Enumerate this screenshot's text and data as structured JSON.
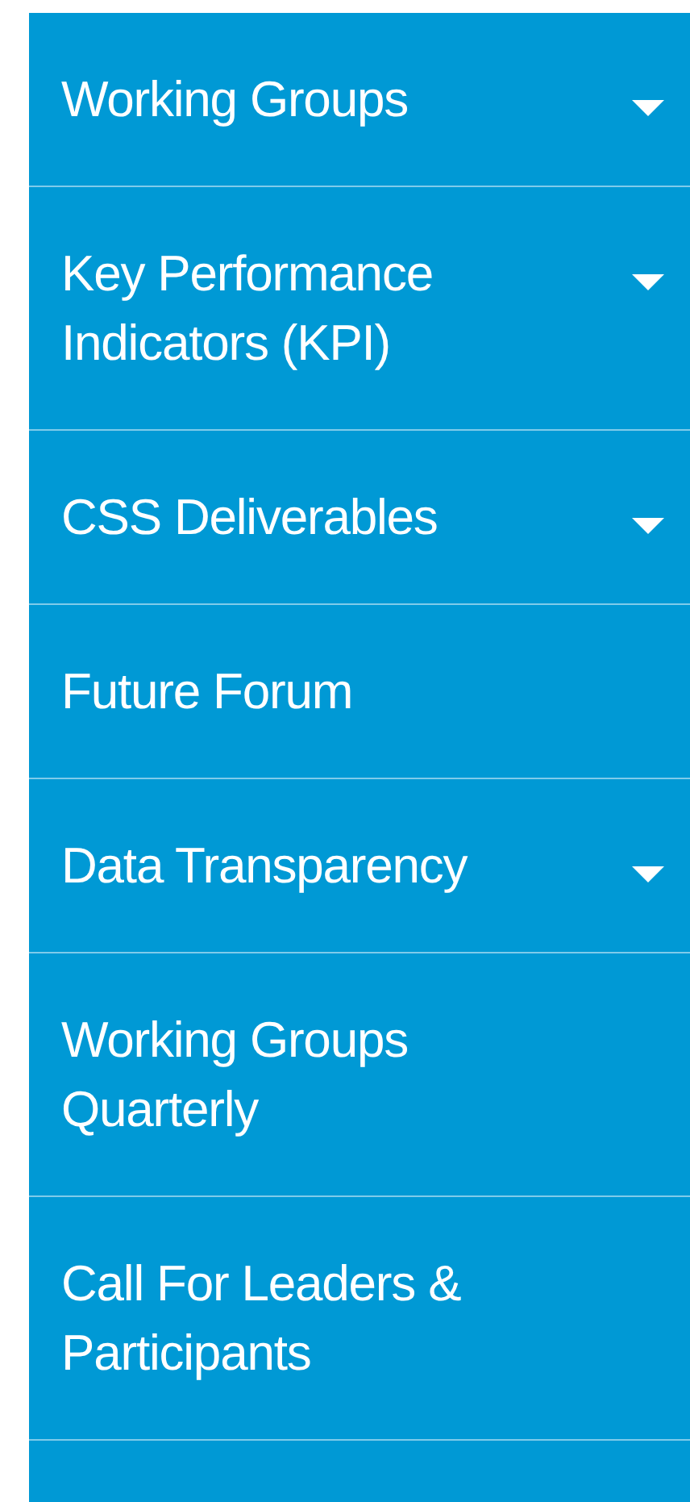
{
  "menu": {
    "items": [
      {
        "label": "Working Groups",
        "has_submenu": true
      },
      {
        "label": "Key Performance Indicators (KPI)",
        "has_submenu": true
      },
      {
        "label": "CSS Deliverables",
        "has_submenu": true
      },
      {
        "label": "Future Forum",
        "has_submenu": false
      },
      {
        "label": "Data Transparency",
        "has_submenu": true
      },
      {
        "label": "Working Groups Quarterly",
        "has_submenu": false
      },
      {
        "label": "Call For Leaders & Participants",
        "has_submenu": false
      }
    ]
  }
}
